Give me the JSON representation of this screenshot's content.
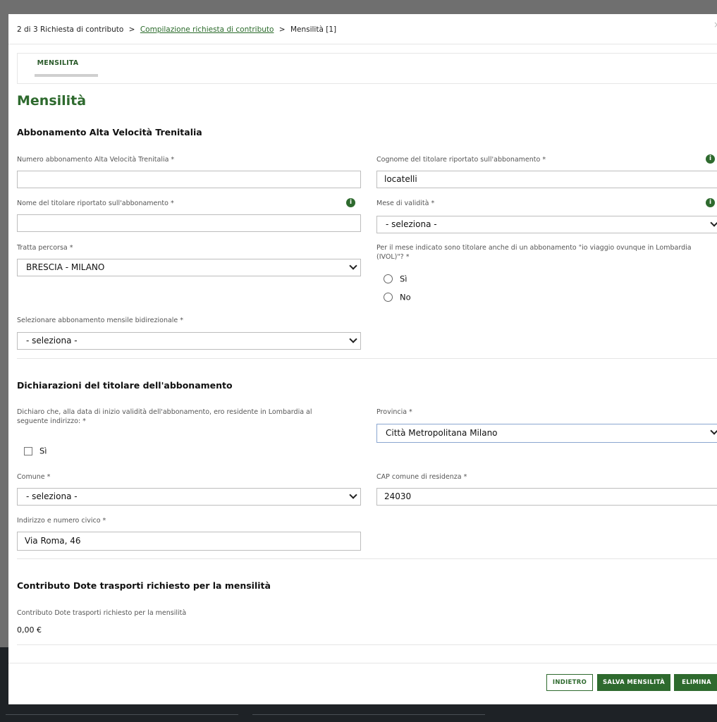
{
  "breadcrumb": {
    "step": "2 di 3 Richiesta di contributo",
    "link": "Compilazione richiesta di contributo",
    "current": "Mensilità [1]",
    "sep1": ">",
    "sep2": ">"
  },
  "tabs": [
    {
      "label": "MENSILITA"
    }
  ],
  "page_title": "Mensilità",
  "section_abbonamento": {
    "title": "Abbonamento Alta Velocità Trenitalia",
    "numero_label": "Numero abbonamento Alta Velocità Trenitalia *",
    "numero_value": "",
    "cognome_label": "Cognome del titolare riportato sull'abbonamento *",
    "cognome_value": "locatelli",
    "nome_label": "Nome del titolare riportato sull'abbonamento *",
    "nome_value": "",
    "mese_label": "Mese di validità *",
    "mese_value": "- seleziona -",
    "tratta_label": "Tratta percorsa *",
    "tratta_value": "BRESCIA - MILANO",
    "ivol_label": "Per il mese indicato sono titolare anche di un abbonamento \"io viaggio ovunque in Lombardia (IVOL)\"? *",
    "ivol_options": [
      "Sì",
      "No"
    ],
    "bidirezionale_label": "Selezionare abbonamento mensile bidirezionale *",
    "bidirezionale_value": "- seleziona -"
  },
  "section_dichiarazioni": {
    "title": "Dichiarazioni del titolare dell'abbonamento",
    "residente_label": "Dichiaro che, alla data di inizio validità dell'abbonamento, ero residente in Lombardia al seguente indirizzo: *",
    "residente_option": "Sì",
    "provincia_label": "Provincia *",
    "provincia_value": "Città Metropolitana Milano",
    "comune_label": "Comune *",
    "comune_value": "- seleziona -",
    "cap_label": "CAP comune di residenza *",
    "cap_value": "24030",
    "indirizzo_label": "Indirizzo e numero civico *",
    "indirizzo_value": "Via Roma, 46"
  },
  "section_contributo": {
    "title": "Contributo Dote trasporti richiesto per la mensilità",
    "label": "Contributo Dote trasporti richiesto per la mensilità",
    "value": "0,00 €"
  },
  "buttons": {
    "back": "INDIETRO",
    "save": "SALVA MENSILITÀ",
    "delete": "ELIMINA"
  },
  "icons": {
    "info": "info-icon",
    "close": "close-icon",
    "chevron": "chevron-down-icon"
  },
  "colors": {
    "accent": "#2e6a2e"
  }
}
